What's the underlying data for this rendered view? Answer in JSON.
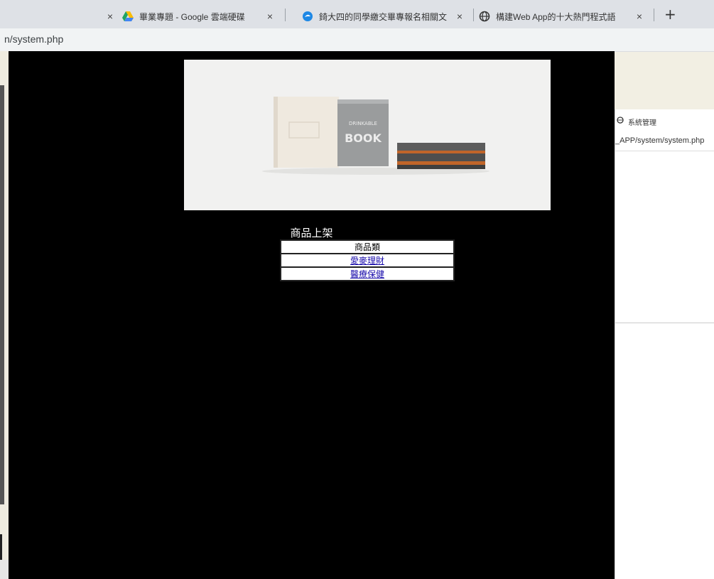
{
  "tabs": [
    {
      "title": "",
      "icon": "blank-icon"
    },
    {
      "title": "畢業專題 - Google 雲端硬碟",
      "icon": "google-drive-icon"
    },
    {
      "title": "錡大四的同學繳交畢專報名相關文",
      "icon": "edge-icon"
    },
    {
      "title": "構建Web App的十大熱門程式語",
      "icon": "globe-icon"
    }
  ],
  "new_tab_label": "+",
  "close_glyph": "×",
  "address": {
    "url": "n/system.php"
  },
  "page": {
    "banner_text": "DRINKABLE BOOK",
    "heading": "商品上架",
    "table_header": "商品類",
    "links": [
      "愛麥理財",
      "醫療保健"
    ]
  },
  "right_window": {
    "title": "系統管理",
    "url": "_APP/system/system.php"
  }
}
